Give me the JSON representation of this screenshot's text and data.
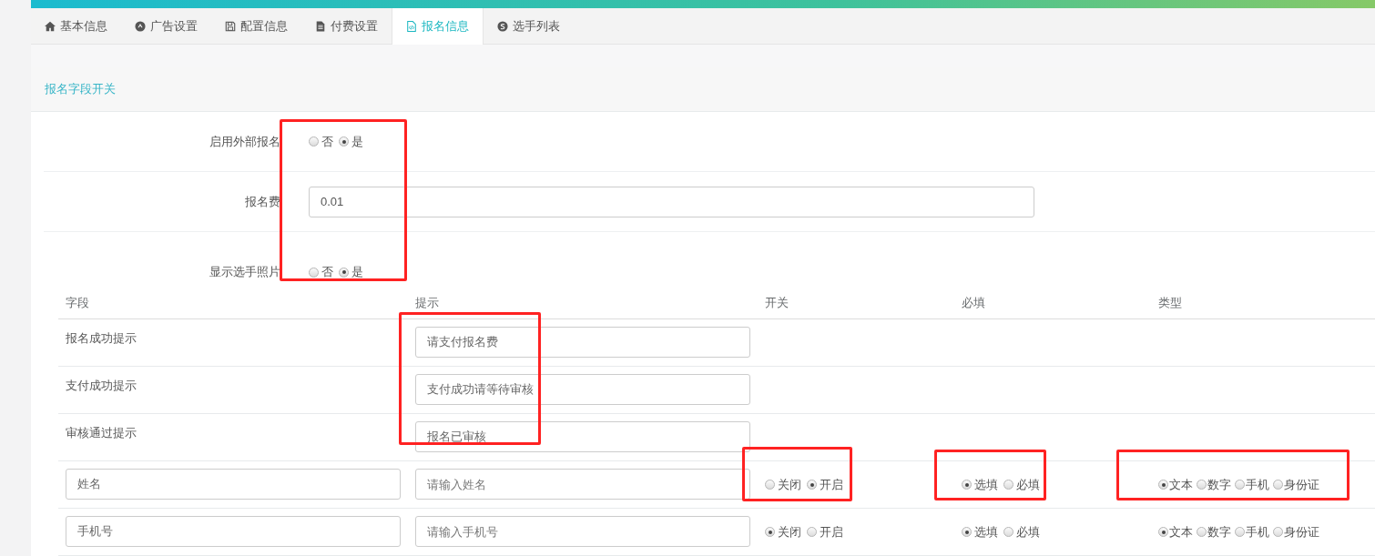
{
  "tabs": [
    {
      "label": "基本信息",
      "selected": false
    },
    {
      "label": "广告设置",
      "selected": false
    },
    {
      "label": "配置信息",
      "selected": false
    },
    {
      "label": "付费设置",
      "selected": false
    },
    {
      "label": "报名信息",
      "selected": true
    },
    {
      "label": "选手列表",
      "selected": false
    }
  ],
  "panel": {
    "title": "报名字段开关"
  },
  "form": {
    "highlighted": true,
    "rows": [
      {
        "label": "启用外部报名",
        "kind": "radio",
        "options": [
          {
            "label": "否",
            "selected": false
          },
          {
            "label": "是",
            "selected": true
          }
        ]
      },
      {
        "label": "报名费",
        "kind": "input",
        "value": "0.01"
      },
      {
        "label": "显示选手照片",
        "kind": "radio",
        "options": [
          {
            "label": "否",
            "selected": false
          },
          {
            "label": "是",
            "selected": true
          }
        ]
      }
    ]
  },
  "table": {
    "columns": [
      "字段",
      "提示",
      "开关",
      "必填",
      "类型"
    ],
    "tips_highlighted": true,
    "tip_rows": [
      {
        "label": "报名成功提示",
        "value": "请支付报名费"
      },
      {
        "label": "支付成功提示",
        "value": "支付成功请等待审核"
      },
      {
        "label": "审核通过提示",
        "value": "报名已审核"
      }
    ],
    "field_rows": [
      {
        "name": "姓名",
        "placeholder": "请输入姓名",
        "highlighted": true,
        "switch": [
          {
            "label": "关闭",
            "selected": false
          },
          {
            "label": "开启",
            "selected": true
          }
        ],
        "required": [
          {
            "label": "选填",
            "selected": true
          },
          {
            "label": "必填",
            "selected": false
          }
        ],
        "type": [
          {
            "label": "文本",
            "selected": true
          },
          {
            "label": "数字",
            "selected": false
          },
          {
            "label": "手机",
            "selected": false
          },
          {
            "label": "身份证",
            "selected": false
          }
        ]
      },
      {
        "name": "手机号",
        "placeholder": "请输入手机号",
        "highlighted": false,
        "switch": [
          {
            "label": "关闭",
            "selected": true
          },
          {
            "label": "开启",
            "selected": false
          }
        ],
        "required": [
          {
            "label": "选填",
            "selected": true
          },
          {
            "label": "必填",
            "selected": false
          }
        ],
        "type": [
          {
            "label": "文本",
            "selected": true
          },
          {
            "label": "数字",
            "selected": false
          },
          {
            "label": "手机",
            "selected": false
          },
          {
            "label": "身份证",
            "selected": false
          }
        ]
      }
    ]
  }
}
